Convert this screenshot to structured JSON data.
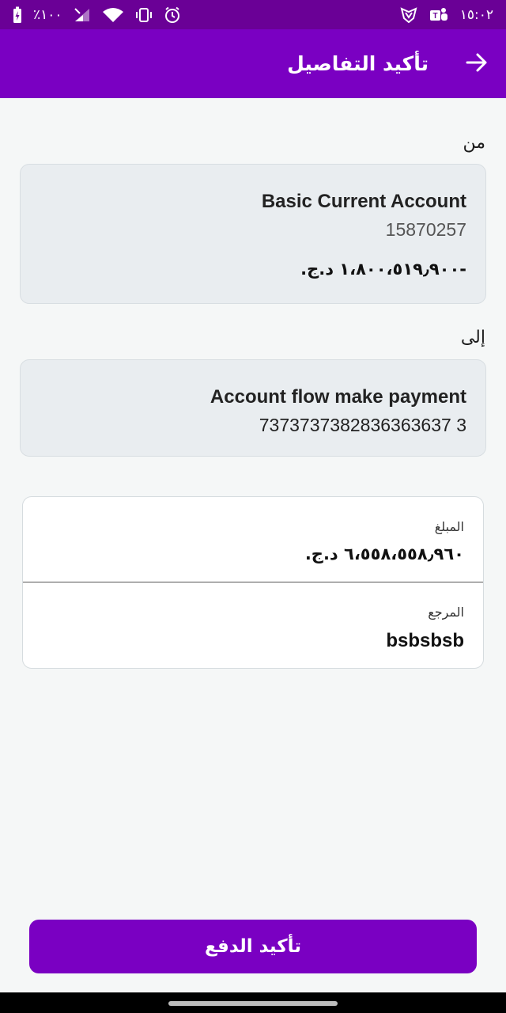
{
  "status_bar": {
    "battery_text": "٪١٠٠",
    "time": "١٥:٠٢",
    "icons": [
      "battery-charging-icon",
      "signal-icon",
      "wifi-icon",
      "vibrate-icon",
      "alarm-icon",
      "shield-icon",
      "teams-icon"
    ]
  },
  "header": {
    "title": "تأكيد التفاصيل",
    "back_icon": "arrow-right-icon"
  },
  "from": {
    "label": "من",
    "account_name": "Basic Current Account",
    "account_number": "15870257",
    "balance": "-١،٨٠٠،٥١٩٫٩٠٠ د.ج."
  },
  "to": {
    "label": "إلى",
    "account_name": "Account flow make payment",
    "account_number": "7373737382836363637 3"
  },
  "details": {
    "amount_label": "المبلغ",
    "amount_value": "٦،٥٥٨،٥٥٨٫٩٦٠ د.ج.",
    "reference_label": "المرجع",
    "reference_value": "bsbsbsb"
  },
  "confirm_button": {
    "label": "تأكيد الدفع"
  },
  "colors": {
    "status_bar": "#6a0096",
    "app_bar": "#7a00c2",
    "button": "#7a00c2",
    "background": "#f5f7f7",
    "card": "#e9edf0"
  }
}
